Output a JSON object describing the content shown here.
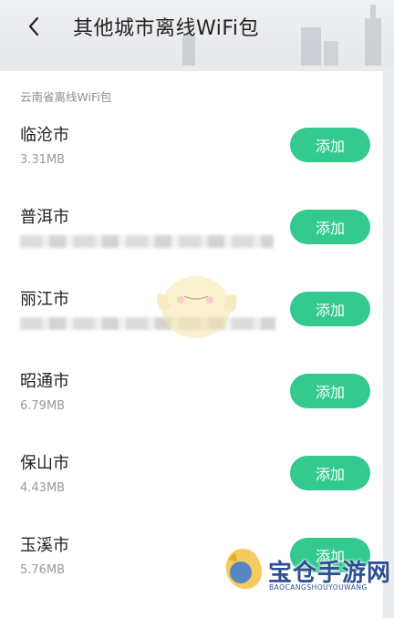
{
  "header": {
    "title": "其他城市离线WiFi包",
    "back_icon": "chevron-left-icon"
  },
  "section": {
    "title": "云南省离线WiFi包"
  },
  "cities": [
    {
      "name": "临沧市",
      "size": "3.31MB",
      "button": "添加"
    },
    {
      "name": "普洱市",
      "size": "",
      "button": "添加"
    },
    {
      "name": "丽江市",
      "size": "",
      "button": "添加"
    },
    {
      "name": "昭通市",
      "size": "6.79MB",
      "button": "添加"
    },
    {
      "name": "保山市",
      "size": "4.43MB",
      "button": "添加"
    },
    {
      "name": "玉溪市",
      "size": "5.76MB",
      "button": "添加"
    }
  ],
  "colors": {
    "accent": "#33c98f",
    "watermark": "#2f4f93"
  },
  "watermark": {
    "text": "宝仓手游网",
    "sub": "BAOCANGSHOUYOUWANG"
  }
}
